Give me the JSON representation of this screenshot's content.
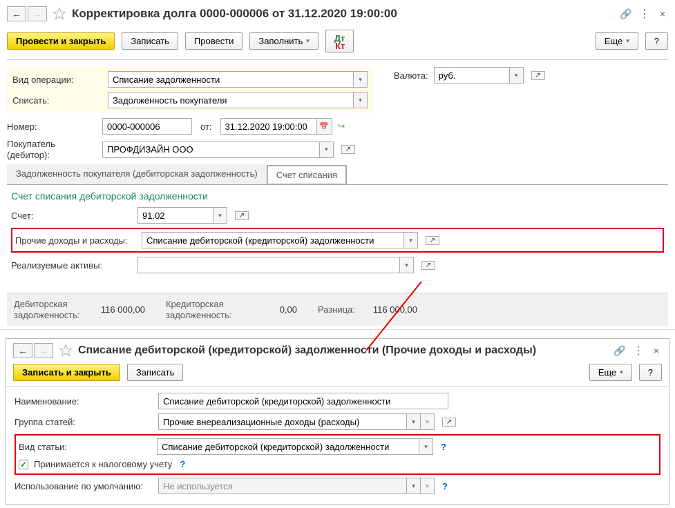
{
  "window1": {
    "title": "Корректировка долга 0000-000006 от 31.12.2020 19:00:00",
    "toolbar": {
      "apply_close": "Провести и закрыть",
      "save": "Записать",
      "apply": "Провести",
      "fill": "Заполнить",
      "more": "Еще"
    },
    "labels": {
      "op_type": "Вид операции:",
      "write_off": "Списать:",
      "number": "Номер:",
      "from": "от:",
      "buyer": "Покупатель (дебитор):",
      "currency": "Валюта:"
    },
    "values": {
      "op_type": "Списание задолженности",
      "write_off": "Задолженность покупателя",
      "number": "0000-000006",
      "date": "31.12.2020 19:00:00",
      "buyer": "ПРОФДИЗАЙН ООО",
      "currency": "руб."
    },
    "tabs": {
      "tab1": "Задолженность покупателя (дебиторская задолженность)",
      "tab2": "Счет списания"
    },
    "section": {
      "title": "Счет списания дебиторской задолженности",
      "account_label": "Счет:",
      "account_value": "91.02",
      "other_label": "Прочие доходы и расходы:",
      "other_value": "Списание дебиторской (кредиторской) задолженности",
      "realized_label": "Реализуемые активы:"
    },
    "footer": {
      "debtor_label": "Дебиторская задолженность:",
      "debtor_val": "116 000,00",
      "creditor_label": "Кредиторская задолженность:",
      "creditor_val": "0,00",
      "diff_label": "Разница:",
      "diff_val": "116 000,00"
    }
  },
  "window2": {
    "title": "Списание дебиторской (кредиторской) задолженности (Прочие доходы и расходы)",
    "toolbar": {
      "save_close": "Записать и закрыть",
      "save": "Записать",
      "more": "Еще"
    },
    "labels": {
      "name": "Наименование:",
      "group": "Группа статей:",
      "type": "Вид статьи:",
      "tax": "Принимается к налоговому учету",
      "default": "Использование по умолчанию:"
    },
    "values": {
      "name": "Списание дебиторской (кредиторской) задолженности",
      "group": "Прочие внереализационные доходы (расходы)",
      "type": "Списание дебиторской (кредиторской) задолженности",
      "default": "Не используется"
    }
  }
}
